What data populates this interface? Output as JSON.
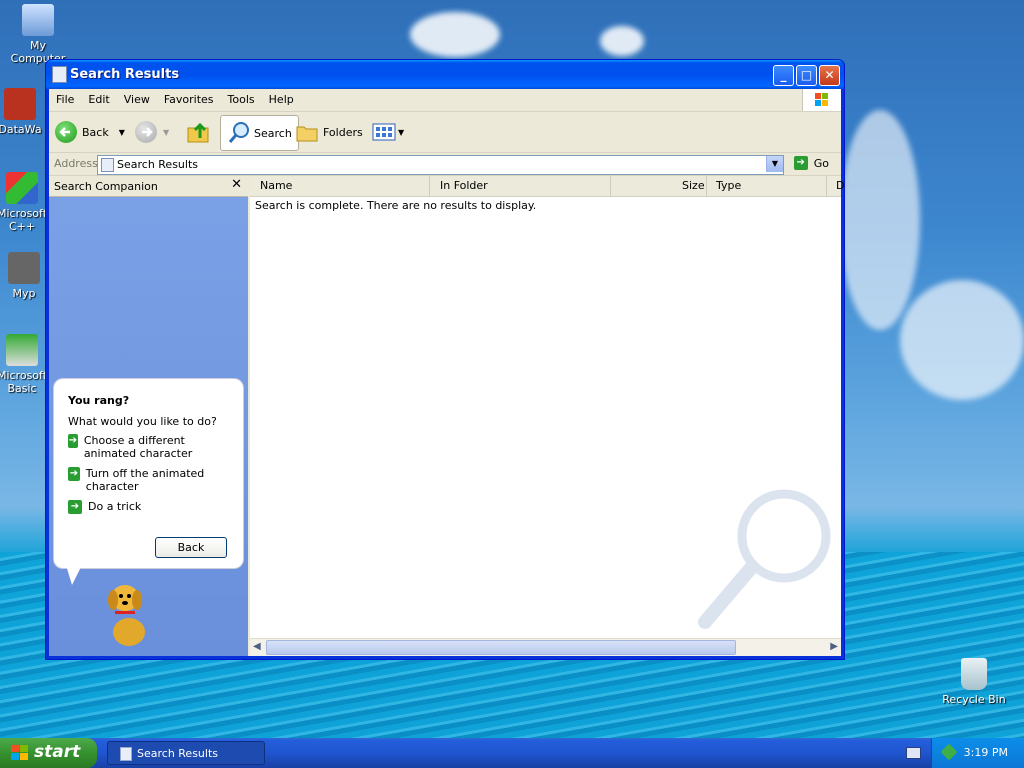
{
  "desktop": {
    "icons": [
      {
        "label": "My Computer"
      },
      {
        "label": "DataWa"
      },
      {
        "label": "Microsoft C++"
      },
      {
        "label": "Myp"
      },
      {
        "label": "Microsoft Basic"
      },
      {
        "label": "Recycle Bin"
      }
    ]
  },
  "window": {
    "title": "Search Results",
    "menu": [
      "File",
      "Edit",
      "View",
      "Favorites",
      "Tools",
      "Help"
    ],
    "toolbar": {
      "back_label": "Back",
      "search_label": "Search",
      "folders_label": "Folders"
    },
    "address": {
      "label": "Address",
      "value": "Search Results",
      "go_label": "Go"
    },
    "companion": {
      "title": "Search Companion",
      "bubble_title": "You rang?",
      "prompt": "What would you like to do?",
      "options": [
        "Choose a different animated character",
        "Turn off the animated character",
        "Do a trick"
      ],
      "back_button": "Back"
    },
    "list": {
      "columns": [
        "Name",
        "In Folder",
        "Size",
        "Type",
        "D"
      ],
      "message": "Search is complete. There are no results to display."
    }
  },
  "taskbar": {
    "start_label": "start",
    "task_label": "Search Results",
    "clock": "3:19 PM"
  },
  "colors": {
    "title_blue": "#0053ee",
    "start_green": "#36912f",
    "pane_blue": "#7ba2e7"
  }
}
